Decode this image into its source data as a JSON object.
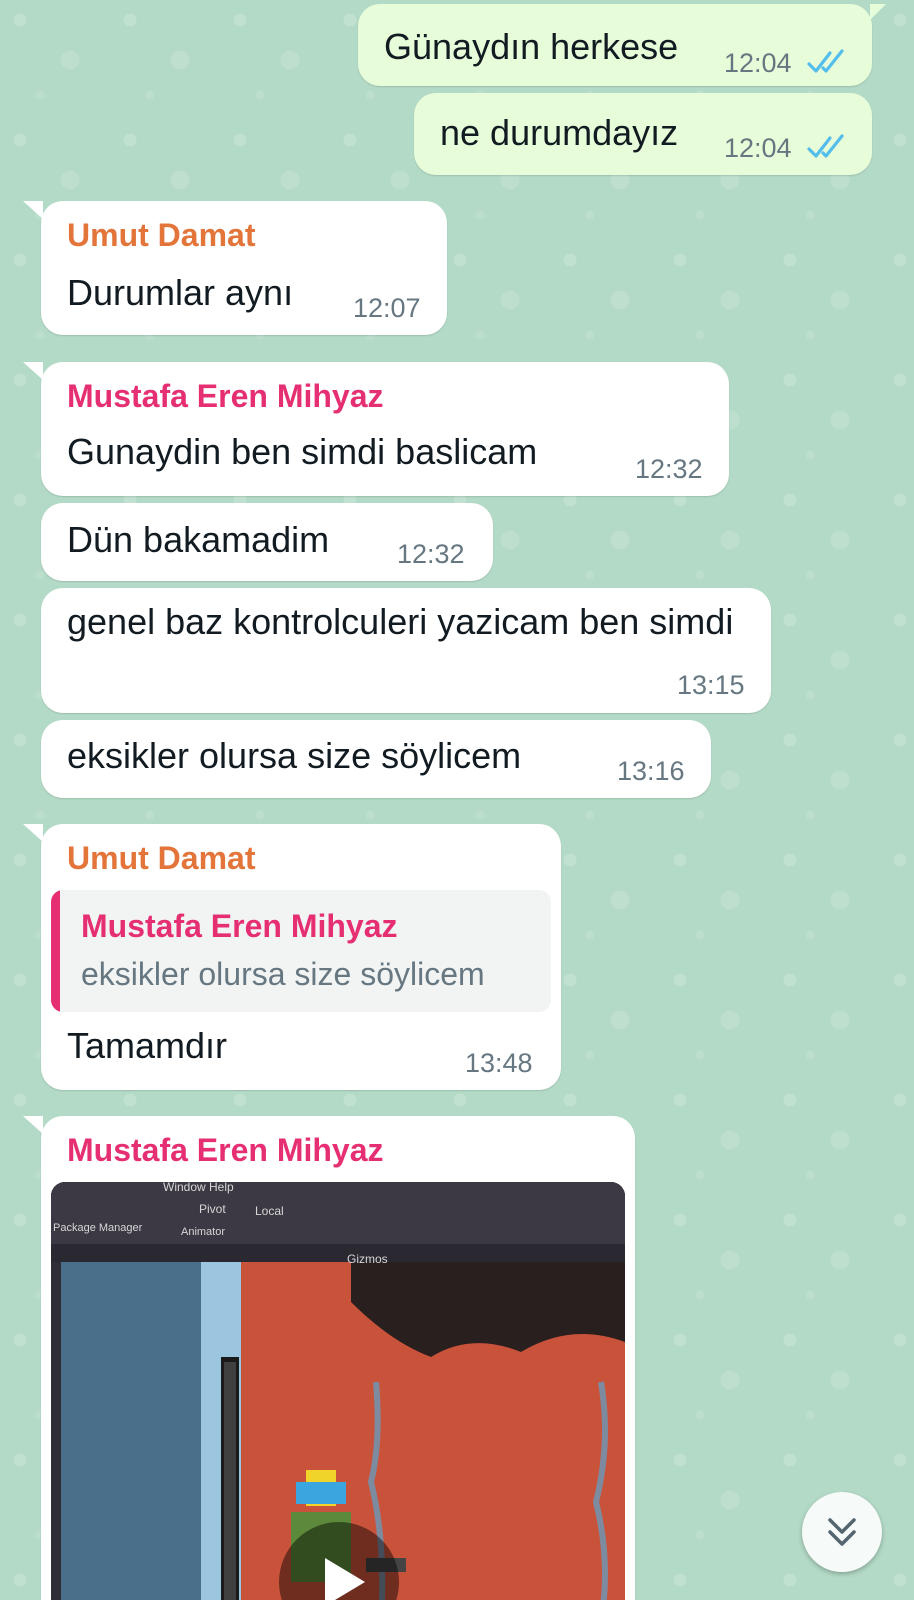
{
  "colors": {
    "outgoing_bubble": "#e7fcd9",
    "incoming_bubble": "#ffffff",
    "read_ticks": "#53bdeb",
    "sender_umut": "#e3753b",
    "sender_mustafa": "#e52f72",
    "wallpaper": "#b3dac6"
  },
  "messages": [
    {
      "direction": "out",
      "text": "Günaydın herkese",
      "time": "12:04",
      "status": "read"
    },
    {
      "direction": "out",
      "text": "ne durumdayız",
      "time": "12:04",
      "status": "read"
    },
    {
      "direction": "in",
      "sender": "Umut Damat",
      "text": "Durumlar aynı",
      "time": "12:07"
    },
    {
      "direction": "in",
      "sender": "Mustafa Eren Mihyaz",
      "text": "Gunaydin ben simdi baslicam",
      "time": "12:32"
    },
    {
      "direction": "in",
      "text": "Dün bakamadim",
      "time": "12:32"
    },
    {
      "direction": "in",
      "text": "genel baz kontrolculeri yazicam ben simdi",
      "time": "13:15"
    },
    {
      "direction": "in",
      "text": "eksikler olursa size söylicem",
      "time": "13:16"
    },
    {
      "direction": "in",
      "sender": "Umut Damat",
      "reply": {
        "sender": "Mustafa Eren Mihyaz",
        "text": "eksikler olursa size söylicem"
      },
      "text": "Tamamdır",
      "time": "13:48"
    },
    {
      "direction": "in",
      "sender": "Mustafa Eren Mihyaz",
      "media": "video"
    }
  ],
  "video_overlay_text": {
    "menu": "Window   Help",
    "pivot": "Pivot",
    "local": "Local",
    "package_manager": "Package Manager",
    "animator": "Animator",
    "gizmos": "Gizmos"
  },
  "icons": {
    "read_receipt": "double-check-icon",
    "play": "play-icon",
    "scroll_down": "double-chevron-down-icon"
  }
}
